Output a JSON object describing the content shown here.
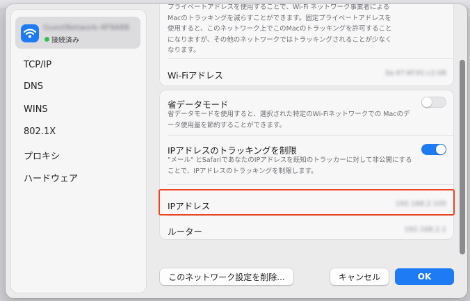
{
  "sidebar": {
    "network": {
      "name": "GuestNetwork-4F9A88",
      "status": "接続済み"
    },
    "items": [
      {
        "label": "TCP/IP"
      },
      {
        "label": "DNS"
      },
      {
        "label": "WINS"
      },
      {
        "label": "802.1X"
      },
      {
        "label": "プロキシ"
      },
      {
        "label": "ハードウェア"
      }
    ]
  },
  "main": {
    "private_address_desc": "プライベートアドレスを使用することで、Wi-Fi ネットワーク事業者によるMacのトラッキングを減らすことができます。固定プライベートアドレスを使用すると、このネットワーク上でこのMacのトラッキングを許可することになりますが、その他のネットワークではトラッキングされることが少なくなります。",
    "wifi_address": {
      "label": "Wi-Fiアドレス",
      "value": "3a:47:6f:91:c2:08"
    },
    "low_data_mode": {
      "label": "省データモード",
      "desc": "省データモードを使用すると、選択された特定のWi-Fiネットワークでの Macのデータ使用量を節約することができます。",
      "enabled": false
    },
    "limit_ip_tracking": {
      "label": "IPアドレスのトラッキングを制限",
      "desc": "\"メール\" とSafariであなたのIPアドレスを既知のトラッカーに対して非公開にすることで、IPアドレスのトラッキングを制限します。",
      "enabled": true
    },
    "ip_address": {
      "label": "IPアドレス",
      "value": "192.168.2.105"
    },
    "router": {
      "label": "ルーター",
      "value": "192.168.2.1"
    }
  },
  "footer": {
    "delete_label": "このネットワーク設定を削除...",
    "cancel_label": "キャンセル",
    "ok_label": "OK"
  },
  "colors": {
    "accent": "#1f7bf3",
    "highlight": "#ee4422",
    "connected": "#30c24a"
  }
}
